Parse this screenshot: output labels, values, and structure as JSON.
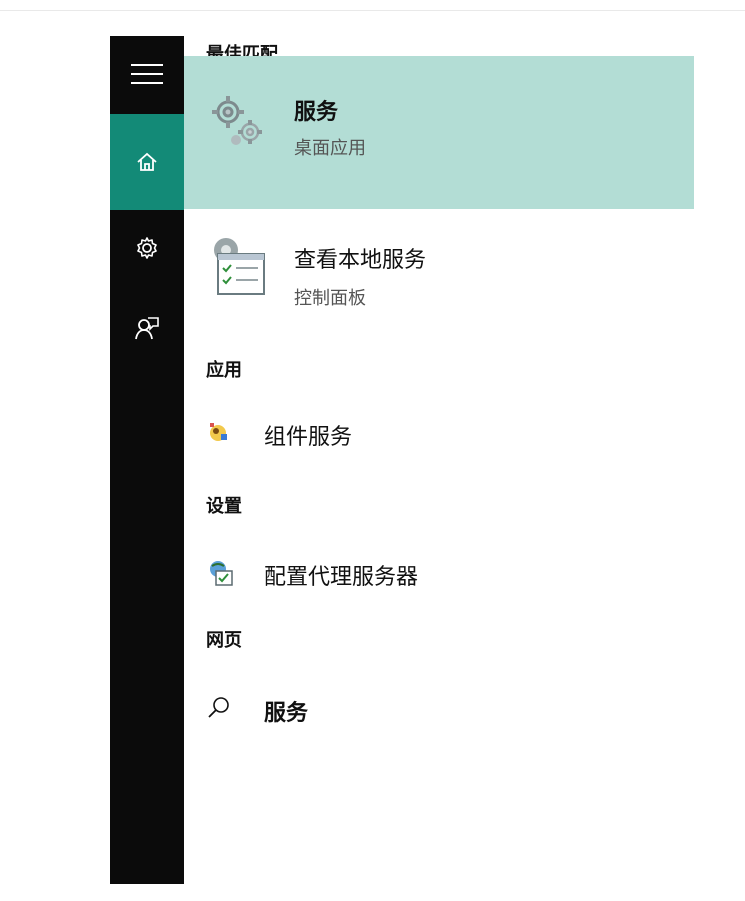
{
  "rail": {
    "menu_icon": "hamburger-icon",
    "home_icon": "home-icon",
    "settings_icon": "gear-icon",
    "feedback_icon": "feedback-icon",
    "accent": "#138a77",
    "bg": "#0b0b0b"
  },
  "sections": {
    "best_match": "最佳匹配",
    "apps": "应用",
    "settings": "设置",
    "web": "网页"
  },
  "best_match": {
    "title": "服务",
    "subtitle": "桌面应用",
    "icon": "services-gear-icon",
    "highlight": "#b3ddd5"
  },
  "control_panel_item": {
    "title": "查看本地服务",
    "subtitle": "控制面板",
    "icon": "control-panel-services-icon"
  },
  "apps_item": {
    "label": "组件服务",
    "icon": "component-services-icon"
  },
  "settings_item": {
    "label": "配置代理服务器",
    "icon": "proxy-settings-icon"
  },
  "web_item": {
    "label": "服务",
    "icon": "search-icon"
  }
}
